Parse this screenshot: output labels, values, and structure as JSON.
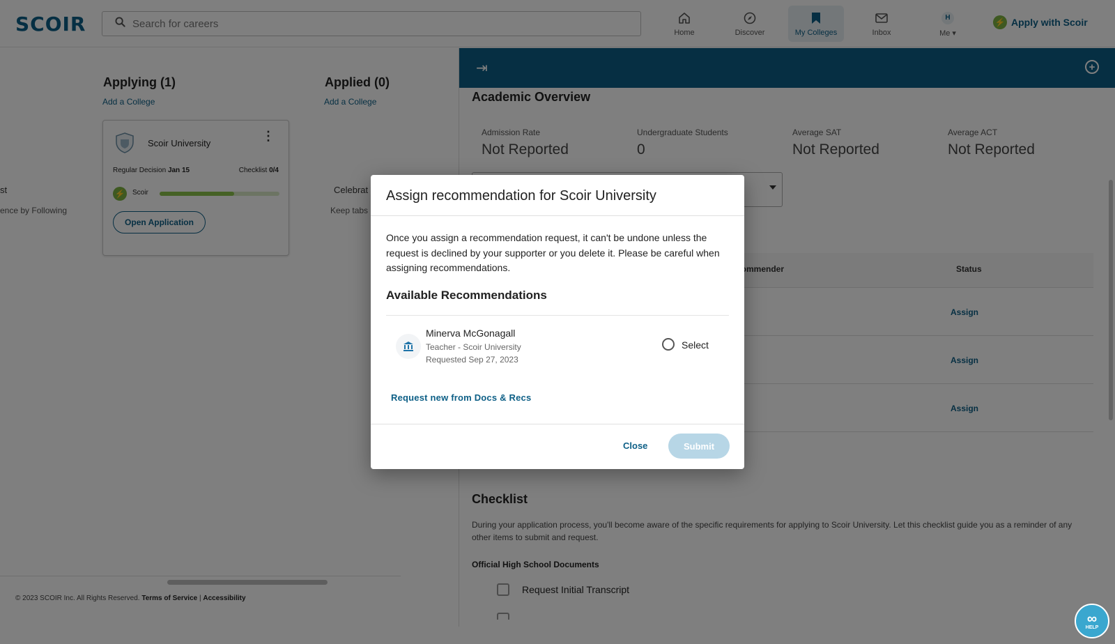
{
  "brand": {
    "logo": "SCOIR",
    "accent": "#0d5f86",
    "progress_color": "#8bc34a"
  },
  "search": {
    "placeholder": "Search for careers"
  },
  "nav": {
    "home": "Home",
    "discover": "Discover",
    "my_colleges": "My Colleges",
    "inbox": "Inbox",
    "me": "Me",
    "me_initial": "H",
    "apply": "Apply with Scoir"
  },
  "board": {
    "applying_title": "Applying (1)",
    "applied_title": "Applied (0)",
    "add_college": "Add a College",
    "card": {
      "college": "Scoir University",
      "decision_label": "Regular Decision",
      "decision_date": "Jan 15",
      "checklist_label": "Checklist",
      "checklist_value": "0/4",
      "platform": "Scoir",
      "progress": 0.62,
      "open_button": "Open Application"
    },
    "left_fragment_1": "st",
    "left_fragment_2": "ence by Following",
    "mid_fragment_1": "Celebrat",
    "mid_fragment_2": "Keep tabs"
  },
  "footer": {
    "copyright": "© 2023 SCOIR Inc. All Rights Reserved.",
    "terms": "Terms of Service",
    "divider": "|",
    "accessibility": "Accessibility"
  },
  "panel": {
    "academic_title": "Academic Overview",
    "stats": [
      {
        "label": "Admission Rate",
        "value": "Not Reported"
      },
      {
        "label": "Undergraduate Students",
        "value": "0"
      },
      {
        "label": "Average SAT",
        "value": "Not Reported"
      },
      {
        "label": "Average ACT",
        "value": "Not Reported"
      }
    ],
    "table": {
      "recommender_header": "commender",
      "status_header": "Status",
      "rows": [
        {
          "status": "Assign"
        },
        {
          "status": "Assign"
        },
        {
          "status": "Assign"
        }
      ]
    },
    "checklist_title": "Checklist",
    "checklist_desc": "During your application process, you'll become aware of the specific requirements for applying to Scoir University. Let this checklist guide you as a reminder of any other items to submit and request.",
    "official_docs": "Official High School Documents",
    "checklist_items": [
      "Request Initial Transcript"
    ]
  },
  "modal": {
    "title": "Assign recommendation for Scoir University",
    "body": "Once you assign a recommendation request, it can't be undone unless the request is declined by your supporter or you delete it. Please be careful when assigning recommendations.",
    "available_title": "Available Recommendations",
    "recommendation": {
      "name": "Minerva McGonagall",
      "role": "Teacher - Scoir University",
      "requested": "Requested Sep 27, 2023",
      "select_label": "Select"
    },
    "request_link": "Request new from Docs & Recs",
    "close": "Close",
    "submit": "Submit"
  },
  "help": {
    "label": "HELP"
  }
}
